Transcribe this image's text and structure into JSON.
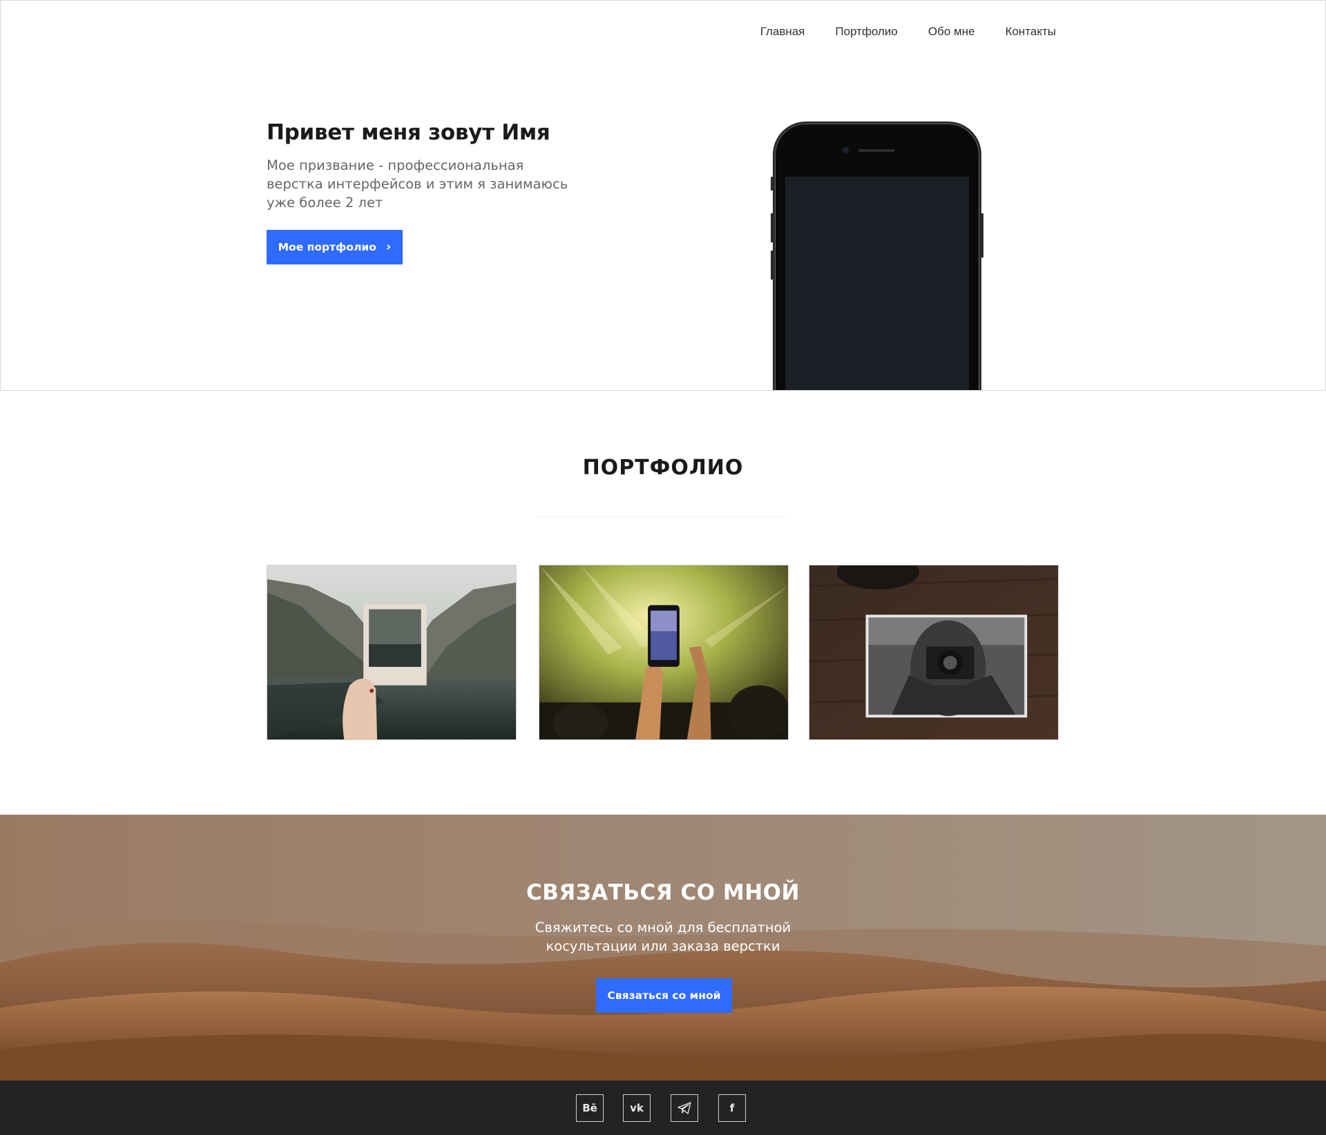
{
  "nav": {
    "items": [
      {
        "label": "Главная"
      },
      {
        "label": "Портфолио"
      },
      {
        "label": "Обо мне"
      },
      {
        "label": "Контакты"
      }
    ]
  },
  "hero": {
    "title": "Привет меня зовут Имя",
    "subtitle": "Мое призвание - профессиональная верстка интерфейсов и этим я занимаюсь уже более 2 лет",
    "button_label": "Мое портфолио",
    "button_icon": "chevron-right-icon",
    "image": "iphone-mockup",
    "accent_color": "#2f6bff"
  },
  "portfolio": {
    "title": "ПОРТФОЛИО",
    "items": [
      {
        "image": "polaroid-canyon-photo"
      },
      {
        "image": "concert-phone-photo"
      },
      {
        "image": "photographer-print-photo"
      }
    ]
  },
  "contact": {
    "title": "СВЯЗАТЬСЯ СО МНОЙ",
    "subtitle": "Свяжитесь  со мной для бесплатной косультации или заказа верстки",
    "button_label": "Связаться со мной",
    "background": "desert-dunes-photo"
  },
  "footer": {
    "social": [
      {
        "label": "Bē",
        "icon": "behance-icon"
      },
      {
        "label": "vk",
        "icon": "vk-icon"
      },
      {
        "label": "telegram",
        "icon": "telegram-icon"
      },
      {
        "label": "f",
        "icon": "facebook-icon"
      }
    ],
    "background_color": "#232323"
  }
}
